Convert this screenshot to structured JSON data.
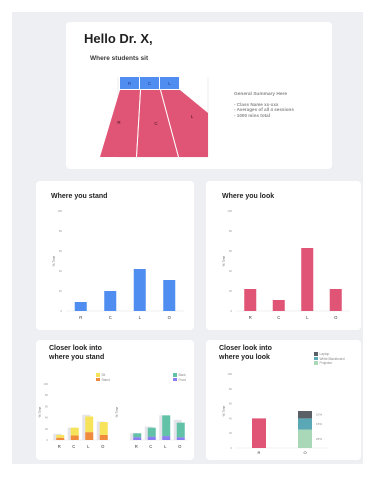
{
  "header": {
    "greeting": "Hello Dr. X,",
    "seat_title": "Where students sit"
  },
  "seating": {
    "columns": [
      "R",
      "C",
      "L"
    ],
    "regions": [
      "R",
      "C",
      "L"
    ],
    "colors": {
      "top": "#4f8df0",
      "regions": "#e05575"
    }
  },
  "summary": {
    "heading": "General Summary Here",
    "lines": [
      "- Class Name xx-xxx",
      "- Averages of all 4 sessions",
      "- 1000 mins total"
    ]
  },
  "stand_card": {
    "title": "Where you stand"
  },
  "look_card": {
    "title": "Where you look"
  },
  "closer_stand_card": {
    "title_line1": "Closer look into",
    "title_line2": "where you stand"
  },
  "closer_look_card": {
    "title_line1": "Closer look into",
    "title_line2": "where you look"
  },
  "colors": {
    "blue": "#4f8df0",
    "pink": "#e05575",
    "yellow": "#f6e35a",
    "orange": "#f08a3c",
    "teal": "#61c2a8",
    "purple": "#8a7ff0"
  },
  "chart_data": [
    {
      "type": "bar",
      "title": "Where you stand",
      "categories": [
        "R",
        "C",
        "L",
        "O"
      ],
      "values": [
        9,
        20,
        42,
        31
      ],
      "ylabel": "% Time",
      "yticks": [
        "100",
        "80",
        "60",
        "40",
        "20",
        "0"
      ],
      "ylim": [
        0,
        100
      ],
      "color": "#4f8df0"
    },
    {
      "type": "bar",
      "title": "Where you look",
      "categories": [
        "R",
        "C",
        "L",
        "O"
      ],
      "values": [
        22,
        11,
        63,
        22
      ],
      "ylabel": "% Time",
      "yticks": [
        "100",
        "80",
        "60",
        "40",
        "20",
        "0"
      ],
      "ylim": [
        0,
        100
      ],
      "color": "#e05575"
    },
    {
      "type": "bar",
      "stacked": true,
      "title": "Closer look into where you stand",
      "categories": [
        "R",
        "C",
        "L",
        "O"
      ],
      "ylabel": "% Time",
      "yticks": [
        "100",
        "80",
        "60",
        "40",
        "20",
        "0"
      ],
      "ylim": [
        0,
        100
      ],
      "legend": "top-right",
      "series": [
        {
          "name": "Stand",
          "color": "#f08a3c",
          "values": [
            4,
            8,
            14,
            9
          ]
        },
        {
          "name": "Sit",
          "color": "#f6e35a",
          "values": [
            5,
            14,
            28,
            23
          ]
        }
      ],
      "background_values": [
        11,
        22,
        45,
        33
      ]
    },
    {
      "type": "bar",
      "stacked": true,
      "title": "Closer look into where you stand",
      "categories": [
        "R",
        "C",
        "L",
        "O"
      ],
      "ylabel": "% Time",
      "ylim": [
        0,
        100
      ],
      "legend": "top-right",
      "series": [
        {
          "name": "Front",
          "color": "#8a7ff0",
          "values": [
            5,
            6,
            7,
            5
          ]
        },
        {
          "name": "Back",
          "color": "#61c2a8",
          "values": [
            7,
            16,
            37,
            26
          ]
        }
      ],
      "background_values": [
        12,
        24,
        44,
        36
      ]
    },
    {
      "type": "bar",
      "stacked": true,
      "title": "Closer look into where you look",
      "categories": [
        "R",
        "O"
      ],
      "ylabel": "% Time",
      "yticks": [
        "100",
        "80",
        "60",
        "40",
        "20",
        "0"
      ],
      "ylim": [
        0,
        100
      ],
      "legend": "top-right",
      "series": [
        {
          "name": "Laptop",
          "color": "#5b6067",
          "values": [
            0,
            10
          ]
        },
        {
          "name": "White Blackboard",
          "color": "#5aa7b6",
          "values": [
            0,
            15
          ]
        },
        {
          "name": "Projector",
          "color": "#a9d8b8",
          "values": [
            40,
            25
          ]
        }
      ],
      "r_color": "#e05575",
      "data_labels": [
        "10%",
        "15%",
        "25%"
      ]
    }
  ]
}
